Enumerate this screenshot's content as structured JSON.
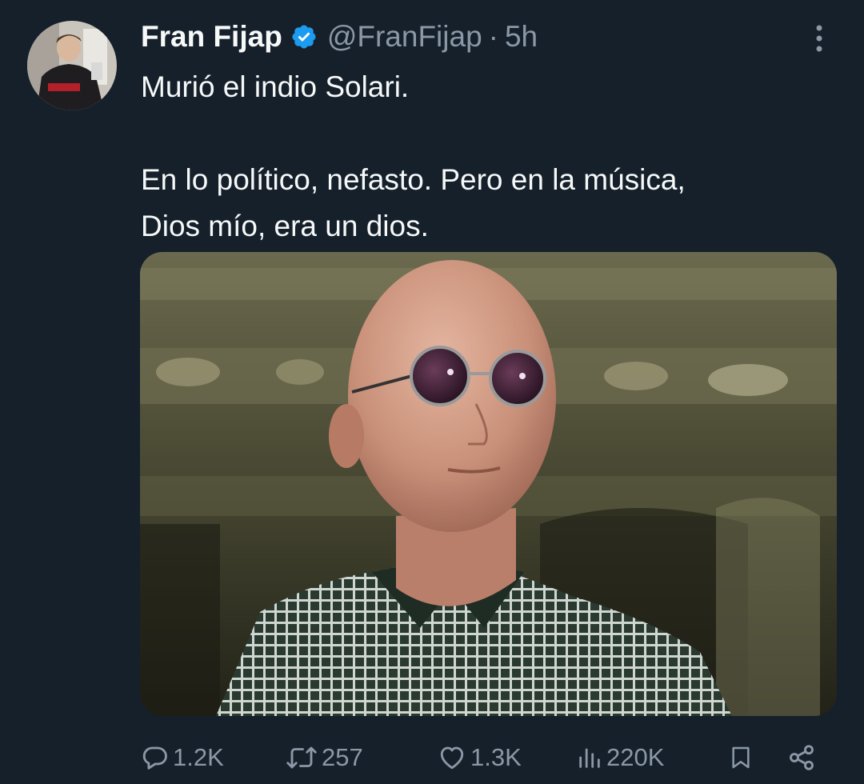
{
  "author": {
    "display_name": "Fran Fijap",
    "handle": "@FranFijap",
    "separator": "·",
    "time": "5h",
    "verified": true
  },
  "tweet": {
    "paragraphs": [
      "Murió el indio Solari.",
      "En lo político, nefasto. Pero en la música,",
      "Dios mío, era un dios."
    ]
  },
  "actions": {
    "replies": "1.2K",
    "retweets": "257",
    "likes": "1.3K",
    "views": "220K"
  },
  "icons": {
    "verified": "verified-badge-icon",
    "more": "more-options-icon",
    "reply": "reply-icon",
    "retweet": "retweet-icon",
    "like": "like-icon",
    "views": "views-icon",
    "bookmark": "bookmark-icon",
    "share": "share-icon"
  },
  "colors": {
    "background": "#15202b",
    "text": "#f7f9f9",
    "secondary": "#8b98a5",
    "verified": "#1d9bf0"
  }
}
